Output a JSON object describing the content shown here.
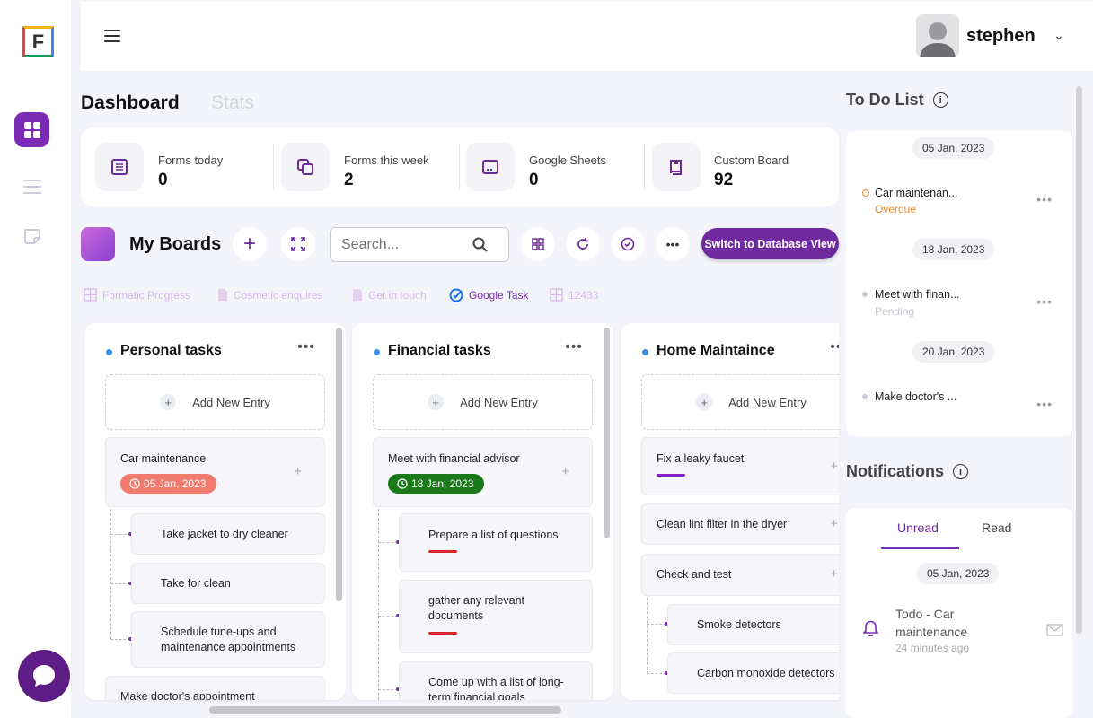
{
  "app": {
    "logo_letter": "F",
    "accent": "#7b2bb5"
  },
  "user": {
    "name": "stephen"
  },
  "tabs": {
    "dashboard": "Dashboard",
    "stats": "Stats"
  },
  "stats": [
    {
      "label": "Forms today",
      "value": "0",
      "icon": "list-icon"
    },
    {
      "label": "Forms this week",
      "value": "2",
      "icon": "copy-icon"
    },
    {
      "label": "Google Sheets",
      "value": "0",
      "icon": "sheet-icon"
    },
    {
      "label": "Custom Board",
      "value": "92",
      "icon": "book-icon"
    }
  ],
  "boards": {
    "title": "My Boards",
    "search_placeholder": "Search...",
    "switch_label": "Switch to Database View",
    "board_tabs": [
      "Formatic Progress",
      "Cosmetic enquires",
      "Get in touch",
      "Google Task",
      "12433"
    ],
    "active_board": "Google Task"
  },
  "columns": [
    {
      "title": "Personal tasks",
      "add_label": "Add New Entry",
      "cards": [
        {
          "title": "Car maintenance",
          "date": "05 Jan, 2023",
          "date_color": "#f07b6e",
          "subtasks": [
            "Take jacket to dry cleaner",
            "Take for clean",
            "Schedule tune-ups and maintenance appointments"
          ]
        },
        {
          "title": "Make doctor's appointment"
        }
      ]
    },
    {
      "title": "Financial tasks",
      "add_label": "Add New Entry",
      "cards": [
        {
          "title": "Meet with financial advisor",
          "date": "18 Jan, 2023",
          "date_color": "#1a7a1a",
          "subtasks": [
            "Prepare a list of questions",
            "gather any relevant documents",
            "Come up with a list of long-term financial goals"
          ]
        }
      ]
    },
    {
      "title": "Home Maintaince",
      "add_label": "Add New Entry",
      "cards": [
        {
          "title": "Fix a leaky faucet"
        },
        {
          "title": "Clean lint filter in the dryer"
        },
        {
          "title": "Check and test",
          "subtasks": [
            "Smoke detectors",
            "Carbon monoxide detectors"
          ]
        }
      ]
    }
  ],
  "todo": {
    "title": "To Do List",
    "groups": [
      {
        "date": "05 Jan, 2023",
        "item": "Car maintenan...",
        "status": "Overdue",
        "status_color": "#f08a2c"
      },
      {
        "date": "18 Jan, 2023",
        "item": "Meet with finan...",
        "status": "Pending",
        "status_color": "#c8c8d0"
      },
      {
        "date": "20 Jan, 2023",
        "item": "Make doctor's ...",
        "status": "",
        "status_color": "#c8c8d0"
      }
    ]
  },
  "notifications": {
    "title": "Notifications",
    "tabs": [
      "Unread",
      "Read"
    ],
    "active_tab": "Unread",
    "date": "05 Jan, 2023",
    "item": {
      "title": "Todo - Car maintenance",
      "time": "24 minutes ago"
    }
  }
}
